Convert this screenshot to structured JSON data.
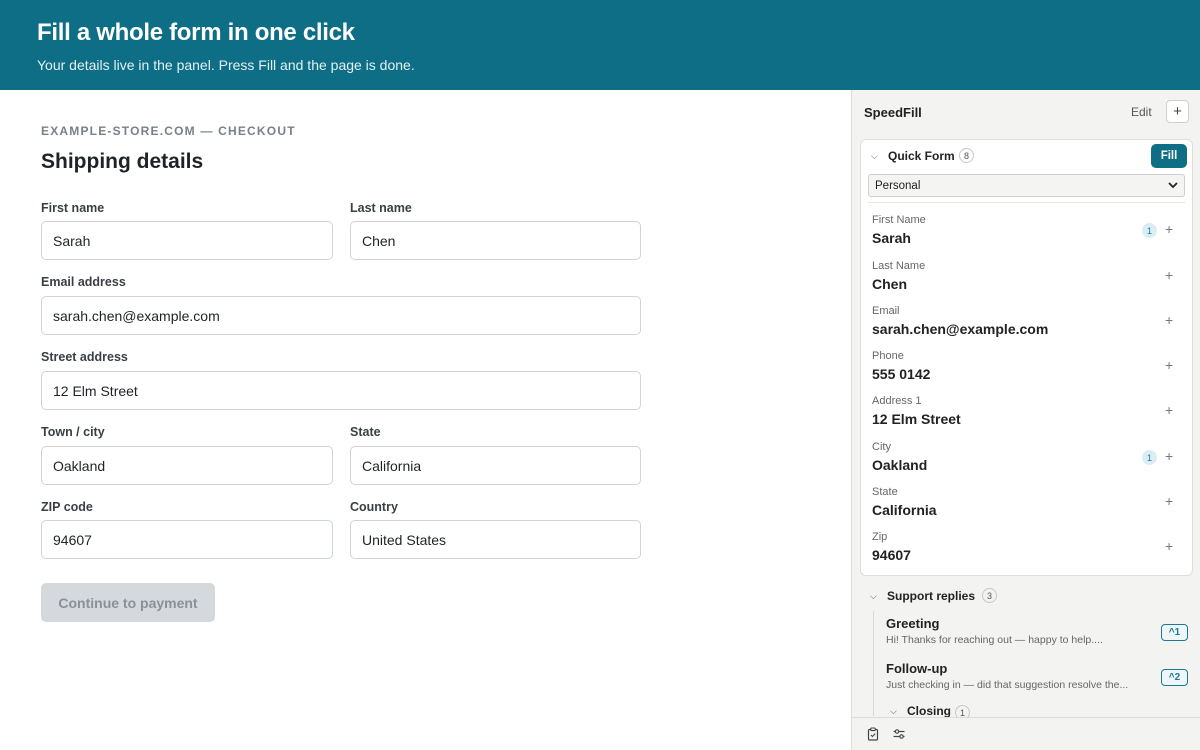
{
  "banner": {
    "title": "Fill a whole form in one click",
    "subtitle": "Your details live in the panel. Press Fill and the page is done."
  },
  "page": {
    "breadcrumb": "EXAMPLE-STORE.COM — CHECKOUT",
    "title": "Shipping details",
    "fields": {
      "first_name": {
        "label": "First name",
        "value": "Sarah"
      },
      "last_name": {
        "label": "Last name",
        "value": "Chen"
      },
      "email": {
        "label": "Email address",
        "value": "sarah.chen@example.com"
      },
      "street": {
        "label": "Street address",
        "value": "12 Elm Street"
      },
      "city": {
        "label": "Town / city",
        "value": "Oakland"
      },
      "state": {
        "label": "State",
        "value": "California"
      },
      "zip": {
        "label": "ZIP code",
        "value": "94607"
      },
      "country": {
        "label": "Country",
        "value": "United States"
      }
    },
    "continue_label": "Continue to payment"
  },
  "panel": {
    "title": "SpeedFill",
    "edit_label": "Edit",
    "add_label": "+",
    "quick_form": {
      "title": "Quick Form",
      "count": "8",
      "fill_label": "Fill",
      "profile": "Personal",
      "fields": [
        {
          "label": "First Name",
          "value": "Sarah",
          "badge": "1"
        },
        {
          "label": "Last Name",
          "value": "Chen",
          "badge": ""
        },
        {
          "label": "Email",
          "value": "sarah.chen@example.com",
          "badge": ""
        },
        {
          "label": "Phone",
          "value": "555 0142",
          "badge": ""
        },
        {
          "label": "Address 1",
          "value": "12 Elm Street",
          "badge": ""
        },
        {
          "label": "City",
          "value": "Oakland",
          "badge": "1"
        },
        {
          "label": "State",
          "value": "California",
          "badge": ""
        },
        {
          "label": "Zip",
          "value": "94607",
          "badge": ""
        }
      ]
    },
    "support": {
      "title": "Support replies",
      "count": "3",
      "snippets": [
        {
          "name": "Greeting",
          "text": "Hi! Thanks for reaching out — happy to help....",
          "shortcut": "^1"
        },
        {
          "name": "Follow-up",
          "text": "Just checking in — did that suggestion resolve the...",
          "shortcut": "^2"
        }
      ],
      "closing": {
        "title": "Closing",
        "count": "1"
      }
    }
  },
  "colors": {
    "accent": "#0e6e85",
    "banner": "#0e6e85"
  },
  "icons": {
    "clipboard": "clipboard-icon",
    "sliders": "sliders-icon"
  }
}
